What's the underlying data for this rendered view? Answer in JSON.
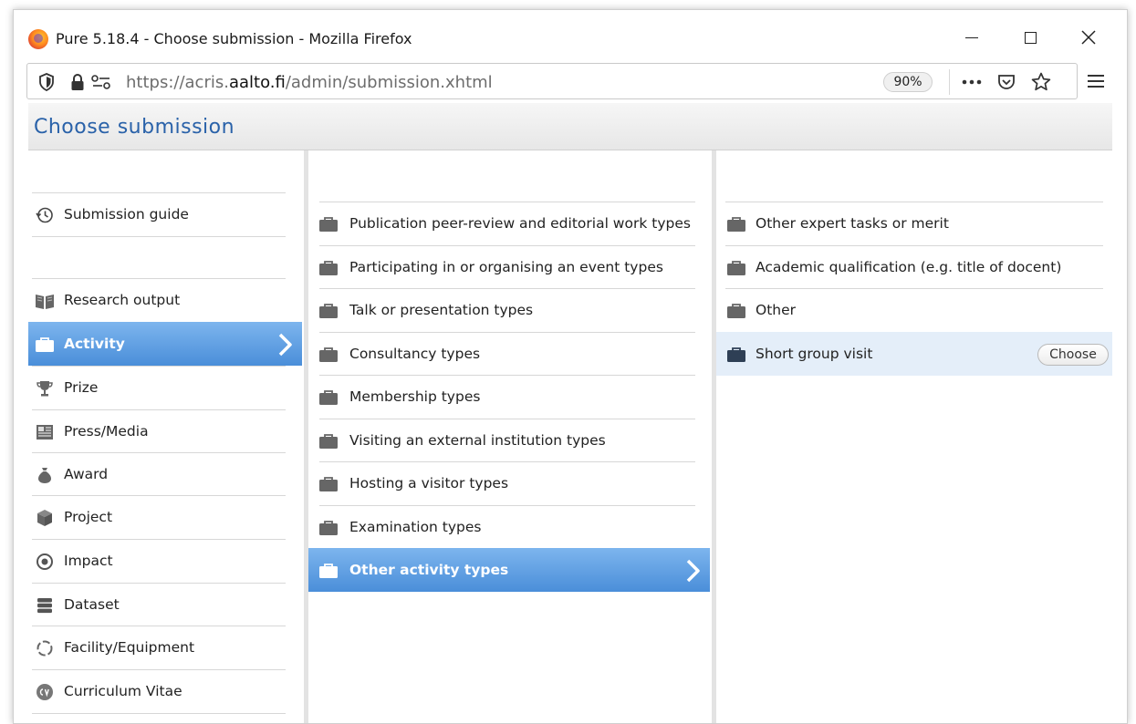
{
  "window": {
    "title": "Pure 5.18.4 - Choose submission - Mozilla Firefox"
  },
  "browser": {
    "url_prefix": "https://acris.",
    "url_domain": "aalto.fi",
    "url_path": "/admin/submission.xhtml",
    "zoom": "90%"
  },
  "page": {
    "title": "Choose submission"
  },
  "col1": {
    "items": [
      {
        "label": "Submission guide",
        "icon": "history-icon"
      },
      {
        "label": "Research output",
        "icon": "book-icon"
      },
      {
        "label": "Activity",
        "icon": "briefcase-icon",
        "active": true
      },
      {
        "label": "Prize",
        "icon": "trophy-icon"
      },
      {
        "label": "Press/Media",
        "icon": "newspaper-icon"
      },
      {
        "label": "Award",
        "icon": "money-bag-icon"
      },
      {
        "label": "Project",
        "icon": "cube-icon"
      },
      {
        "label": "Impact",
        "icon": "target-icon"
      },
      {
        "label": "Dataset",
        "icon": "database-icon"
      },
      {
        "label": "Facility/Equipment",
        "icon": "ring-icon"
      },
      {
        "label": "Curriculum Vitae",
        "icon": "cv-icon"
      }
    ]
  },
  "col2": {
    "items": [
      {
        "label": "Publication peer-review and editorial work types"
      },
      {
        "label": "Participating in or organising an event types"
      },
      {
        "label": "Talk or presentation types"
      },
      {
        "label": "Consultancy types"
      },
      {
        "label": "Membership types"
      },
      {
        "label": "Visiting an external institution types"
      },
      {
        "label": "Hosting a visitor types"
      },
      {
        "label": "Examination types"
      },
      {
        "label": "Other activity types",
        "active": true
      }
    ]
  },
  "col3": {
    "items": [
      {
        "label": "Other expert tasks or merit"
      },
      {
        "label": "Academic qualification (e.g. title of docent)"
      },
      {
        "label": "Other"
      },
      {
        "label": "Short group visit",
        "highlighted": true
      }
    ],
    "choose_label": "Choose"
  },
  "colors": {
    "accent": "#4a8ed9",
    "title_blue": "#2a62a9",
    "highlight": "#e4eef9"
  }
}
